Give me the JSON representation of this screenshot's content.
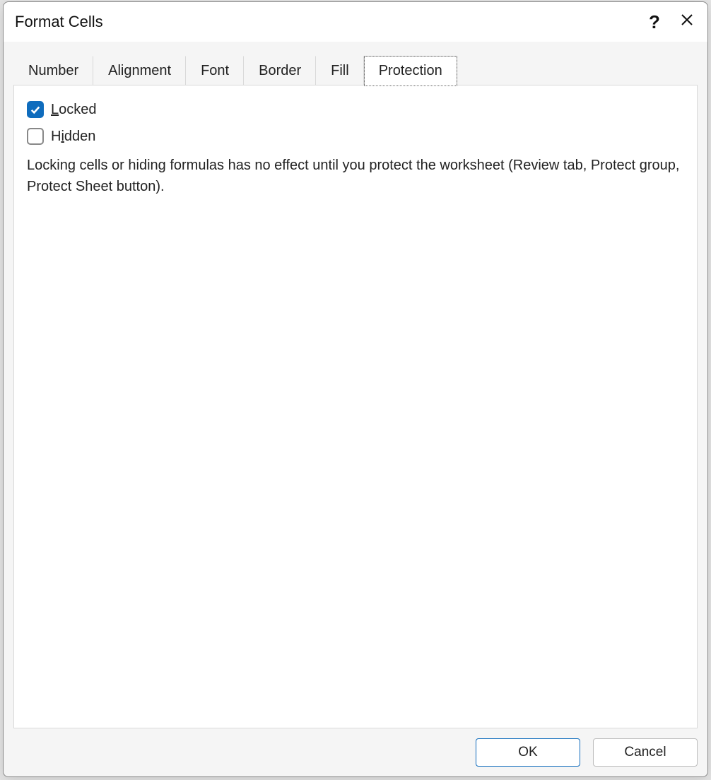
{
  "dialog": {
    "title": "Format Cells"
  },
  "tabs": {
    "number": "Number",
    "alignment": "Alignment",
    "font": "Font",
    "border": "Border",
    "fill": "Fill",
    "protection": "Protection",
    "active": "protection"
  },
  "protection": {
    "locked": {
      "label_pre": "",
      "label_u": "L",
      "label_post": "ocked",
      "checked": true
    },
    "hidden": {
      "label_pre": "H",
      "label_u": "i",
      "label_post": "dden",
      "checked": false
    },
    "description": "Locking cells or hiding formulas has no effect until you protect the worksheet (Review tab, Protect group, Protect Sheet button)."
  },
  "buttons": {
    "ok": "OK",
    "cancel": "Cancel"
  }
}
